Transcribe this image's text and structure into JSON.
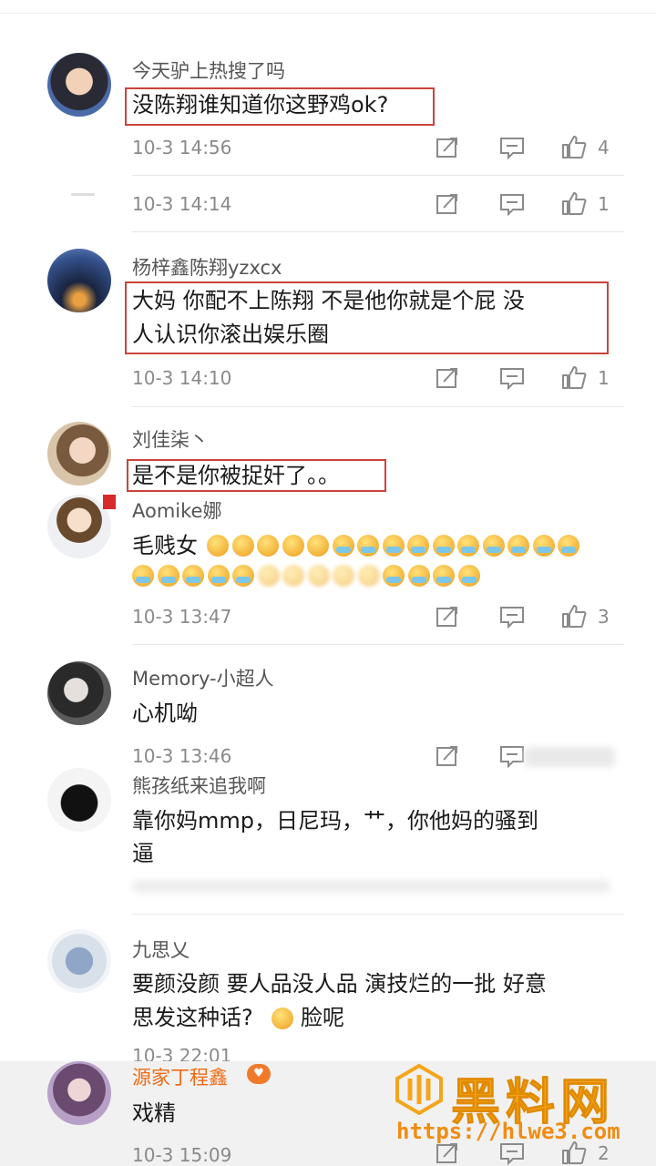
{
  "comments": [
    {
      "user": "今天驴上热搜了吗",
      "text": "没陈翔谁知道你这野鸡ok?",
      "time": "10-3 14:56",
      "likes": "4"
    },
    {
      "user": "",
      "text": "",
      "time": "10-3 14:14",
      "likes": "1"
    },
    {
      "user": "杨梓鑫陈翔yzxcx",
      "text_line1": "大妈  你配不上陈翔  不是他你就是个屁  没",
      "text_line2": "人认识你滚出娱乐圈",
      "time": "10-3 14:10",
      "likes": "1"
    },
    {
      "user": "刘佳柒丶",
      "text": "是不是你被捉奸了。。"
    },
    {
      "user": "Aomike娜",
      "text": "毛贱女",
      "time": "10-3 13:47",
      "likes": "3"
    },
    {
      "user": "Memory-小超人",
      "text": "心机呦",
      "time": "10-3 13:46"
    },
    {
      "user": "熊孩纸来追我啊",
      "text_line1": "靠你妈mmp，日尼玛，艹，你他妈的骚到",
      "text_line2": "逼"
    },
    {
      "user": "九思乂",
      "text_line1": "要颜没颜 要人品没人品 演技烂的一批 好意",
      "text_line2": "思发这种话?",
      "text_line2_tail": "脸呢",
      "time": "10-3 22:01"
    },
    {
      "user": "源家丁程鑫",
      "text": "戏精",
      "time": "10-3 15:09",
      "likes": "2"
    }
  ],
  "watermark": {
    "name": "黑料网",
    "url": "https://hlwe3.com"
  },
  "icons": {
    "repost": "repost-icon",
    "comment": "comment-icon",
    "like": "thumbs-up-icon"
  }
}
